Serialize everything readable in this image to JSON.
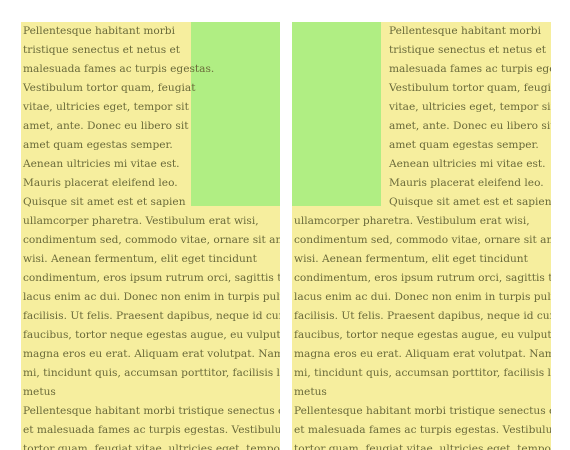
{
  "colors": {
    "column_bg": "#f6ee9e",
    "float_box": "#b0ee83",
    "text": "#6a6a3a"
  },
  "left": {
    "float_lines": [
      "Pellentesque habitant morbi",
      "tristique senectus et netus et",
      "malesuada fames ac turpis egestas.",
      "Vestibulum tortor quam, feugiat",
      "vitae, ultricies eget, tempor sit",
      "amet, ante. Donec eu libero sit",
      "amet quam egestas semper.",
      "Aenean ultricies mi vitae est.",
      "Mauris placerat eleifend leo.",
      "Quisque sit amet est et sapien"
    ],
    "full_lines": [
      "ullamcorper pharetra. Vestibulum erat wisi,",
      "condimentum sed, commodo vitae, ornare sit amet,",
      "wisi. Aenean fermentum, elit eget tincidunt",
      "condimentum, eros ipsum rutrum orci, sagittis tempus",
      "lacus enim ac dui. Donec non enim in turpis pulvinar",
      "facilisis. Ut felis. Praesent dapibus, neque id cursus",
      "faucibus, tortor neque egestas augue, eu vulputate",
      "magna eros eu erat. Aliquam erat volutpat. Nam dui",
      "mi, tincidunt quis, accumsan porttitor, facilisis luctus,",
      "metus",
      "Pellentesque habitant morbi tristique senectus et netus",
      "et malesuada fames ac turpis egestas. Vestibulum",
      "tortor quam, feugiat vitae, ultricies eget, tempor sit"
    ]
  },
  "right": {
    "float_lines": [
      "Pellentesque habitant morbi",
      "tristique senectus et netus et",
      "malesuada fames ac turpis egestas.",
      "Vestibulum tortor quam, feugiat",
      "vitae, ultricies eget, tempor sit",
      "amet, ante. Donec eu libero sit",
      "amet quam egestas semper.",
      "Aenean ultricies mi vitae est.",
      "Mauris placerat eleifend leo.",
      "Quisque sit amet est et sapien"
    ],
    "full_lines": [
      "ullamcorper pharetra. Vestibulum erat wisi,",
      "condimentum sed, commodo vitae, ornare sit amet,",
      "wisi. Aenean fermentum, elit eget tincidunt",
      "condimentum, eros ipsum rutrum orci, sagittis tempus",
      "lacus enim ac dui. Donec non enim in turpis pulvinar",
      "facilisis. Ut felis. Praesent dapibus, neque id cursus",
      "faucibus, tortor neque egestas augue, eu vulputate",
      "magna eros eu erat. Aliquam erat volutpat. Nam dui",
      "mi, tincidunt quis, accumsan porttitor, facilisis luctus,",
      "metus",
      "Pellentesque habitant morbi tristique senectus et netus",
      "et malesuada fames ac turpis egestas. Vestibulum",
      "tortor quam, feugiat vitae, ultricies eget, tempor sit"
    ]
  }
}
